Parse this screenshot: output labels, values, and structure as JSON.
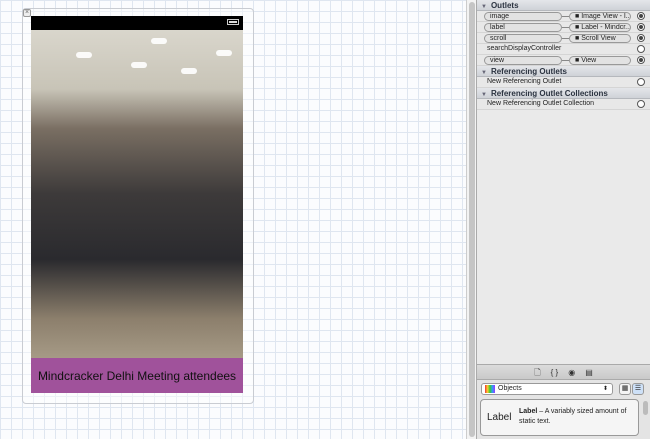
{
  "canvas": {
    "caption": "Mindcracker Delhi  Meeting attendees",
    "close_glyph": "×"
  },
  "inspector": {
    "outlets_header": "Outlets",
    "outlets": [
      {
        "name": "image",
        "target": "Image View - I...",
        "connected": true
      },
      {
        "name": "label",
        "target": "Label - Mindcr...",
        "connected": true
      },
      {
        "name": "scroll",
        "target": "Scroll View",
        "connected": true
      },
      {
        "name": "searchDisplayController",
        "target": null,
        "connected": false
      },
      {
        "name": "view",
        "target": "View",
        "connected": true
      }
    ],
    "ref_outlets_header": "Referencing Outlets",
    "new_ref_outlet": "New Referencing Outlet",
    "ref_collections_header": "Referencing Outlet Collections",
    "new_ref_collection": "New Referencing Outlet Collection",
    "target_bullet": "■"
  },
  "library": {
    "tabs": [
      "🗋",
      "{ }",
      "◉",
      "▤"
    ],
    "selector": "Objects",
    "selector_arrow": "⬍",
    "grid_view_glyph": "▦",
    "list_view_glyph": "☰",
    "item": {
      "preview": "Label",
      "name": "Label",
      "description": " – A variably sized amount of static text."
    }
  },
  "colors": {
    "caption_bg": "#a0529b"
  }
}
